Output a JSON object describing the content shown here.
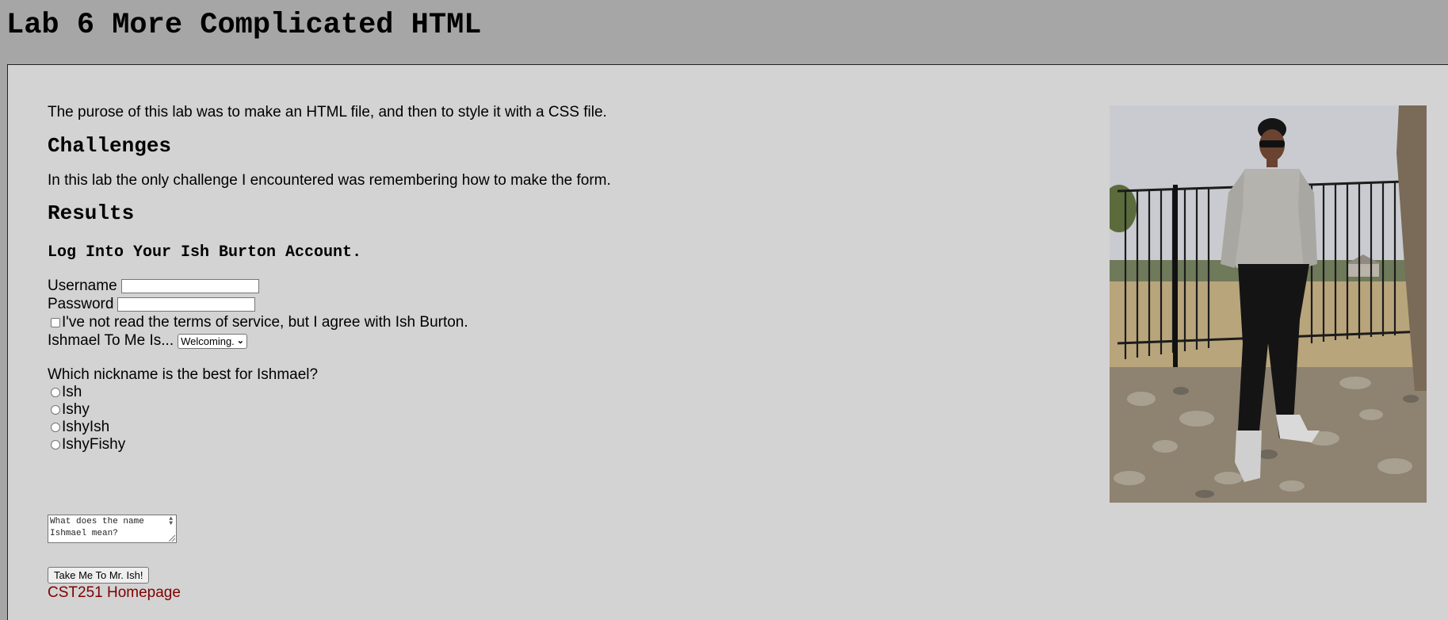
{
  "page": {
    "title": "Lab 6 More Complicated HTML",
    "intro": "The purose of this lab was to make an HTML file, and then to style it with a CSS file.",
    "challenges_heading": "Challenges",
    "challenges_text": "In this lab the only challenge I encountered was remembering how to make the form.",
    "results_heading": "Results"
  },
  "form": {
    "heading": "Log Into Your Ish Burton Account.",
    "username_label": "Username",
    "username_value": "",
    "password_label": "Password",
    "password_value": "",
    "terms_label": "I've not read the terms of service, but I agree with Ish Burton.",
    "terms_checked": false,
    "select_label": "Ishmael To Me Is...",
    "select_value": "Welcoming.",
    "radio_question": "Which nickname is the best for Ishmael?",
    "radio_options": [
      "Ish",
      "Ishy",
      "IshyIsh",
      "IshyFishy"
    ],
    "textarea_placeholder": "What does the name Ishmael mean?",
    "submit_label": "Take Me To Mr. Ish!"
  },
  "footer": {
    "homepage_link": "CST251 Homepage"
  },
  "colors": {
    "page_background": "#a6a6a6",
    "panel_background": "#d3d3d3",
    "link_color": "#800000"
  }
}
